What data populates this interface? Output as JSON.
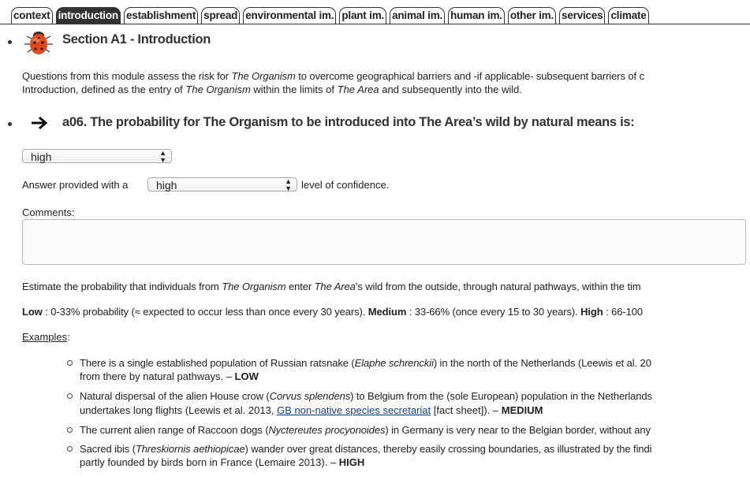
{
  "tabs": [
    {
      "label": "context",
      "active": false
    },
    {
      "label": "introduction",
      "active": true
    },
    {
      "label": "establishment",
      "active": false
    },
    {
      "label": "spread",
      "active": false
    },
    {
      "label": "environmental im.",
      "active": false
    },
    {
      "label": "plant im.",
      "active": false
    },
    {
      "label": "animal im.",
      "active": false
    },
    {
      "label": "human im.",
      "active": false
    },
    {
      "label": "other im.",
      "active": false
    },
    {
      "label": "services",
      "active": false
    },
    {
      "label": "climate",
      "active": false
    }
  ],
  "section": {
    "icon": "ladybug-icon",
    "title": "Section A1 - Introduction"
  },
  "intro": {
    "l1a": "Questions from this module assess the risk for ",
    "l1b": "The Organism",
    "l1c": " to overcome geographical barriers and -if applicable- subsequent barriers of c",
    "l2a": "Introduction, defined as the entry of ",
    "l2b": "The Organism",
    "l2c": " within the limits of ",
    "l2d": "The Area",
    "l2e": " and subsequently into the wild."
  },
  "question": {
    "icon": "arrow-right-icon",
    "title": "a06. The probability for The Organism to be introduced into The Area’s wild by natural means is:"
  },
  "answer": {
    "value": "high"
  },
  "confidence": {
    "prefix": "Answer provided with a",
    "value": "high",
    "suffix": "level of confidence."
  },
  "comments": {
    "label": "Comments:",
    "value": ""
  },
  "estimate": {
    "a": "Estimate the probability that individuals from ",
    "b": "The Organism",
    "c": " enter ",
    "d": "The Area",
    "e": "’s wild from the outside, through natural pathways, within the tim"
  },
  "scale": {
    "low_k": "Low",
    "low_v": " : 0-33% probability (≈ expected to occur less than once every 30 years). ",
    "med_k": "Medium",
    "med_v": " : 33-66% (once every 15 to 30 years). ",
    "high_k": "High",
    "high_v": " : 66-100"
  },
  "examples": {
    "label": "Examples",
    "colon": ":",
    "items": [
      {
        "a": "There is a single established population of Russian ratsnake (",
        "sp": "Elaphe schrenckii",
        "b": ") in the north of the Netherlands (Leewis et al. 20",
        "c": "from there by natural pathways. – ",
        "lvl": "LOW"
      },
      {
        "a": "Natural dispersal of the alien House crow (",
        "sp": "Corvus splendens",
        "b": ") to Belgium from the (sole European) population in the Netherlands",
        "c": "undertakes long flights (Leewis et al. 2013, ",
        "link": "GB non-native species secretariat",
        "d": " [fact sheet]). – ",
        "lvl": "MEDIUM"
      },
      {
        "a": "The current alien range of Raccoon dogs (",
        "sp": "Nyctereutes procyonoides",
        "b": ") in Germany is very near to the Belgian border, without any"
      },
      {
        "a": "Sacred ibis (",
        "sp": "Threskiornis aethiopicae",
        "b": ") wander over great distances, thereby easily crossing boundaries, as illustrated by the findi",
        "c": "partly founded by birds born in France (Lemaire 2013). – ",
        "lvl": "HIGH"
      }
    ]
  }
}
